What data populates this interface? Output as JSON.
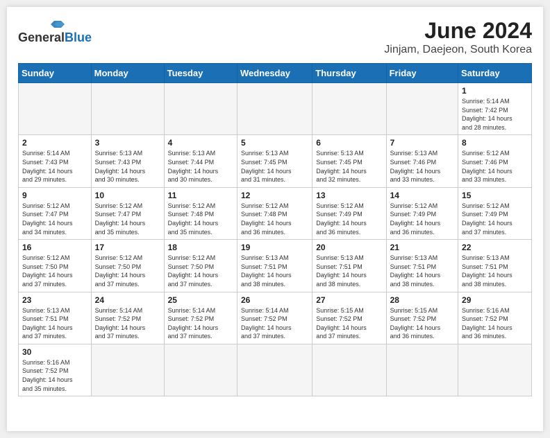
{
  "header": {
    "logo_general": "General",
    "logo_blue": "Blue",
    "month_year": "June 2024",
    "location": "Jinjam, Daejeon, South Korea"
  },
  "weekdays": [
    "Sunday",
    "Monday",
    "Tuesday",
    "Wednesday",
    "Thursday",
    "Friday",
    "Saturday"
  ],
  "weeks": [
    [
      {
        "day": "",
        "info": ""
      },
      {
        "day": "",
        "info": ""
      },
      {
        "day": "",
        "info": ""
      },
      {
        "day": "",
        "info": ""
      },
      {
        "day": "",
        "info": ""
      },
      {
        "day": "",
        "info": ""
      },
      {
        "day": "1",
        "info": "Sunrise: 5:14 AM\nSunset: 7:42 PM\nDaylight: 14 hours\nand 28 minutes."
      }
    ],
    [
      {
        "day": "2",
        "info": "Sunrise: 5:14 AM\nSunset: 7:43 PM\nDaylight: 14 hours\nand 29 minutes."
      },
      {
        "day": "3",
        "info": "Sunrise: 5:13 AM\nSunset: 7:43 PM\nDaylight: 14 hours\nand 30 minutes."
      },
      {
        "day": "4",
        "info": "Sunrise: 5:13 AM\nSunset: 7:44 PM\nDaylight: 14 hours\nand 30 minutes."
      },
      {
        "day": "5",
        "info": "Sunrise: 5:13 AM\nSunset: 7:45 PM\nDaylight: 14 hours\nand 31 minutes."
      },
      {
        "day": "6",
        "info": "Sunrise: 5:13 AM\nSunset: 7:45 PM\nDaylight: 14 hours\nand 32 minutes."
      },
      {
        "day": "7",
        "info": "Sunrise: 5:13 AM\nSunset: 7:46 PM\nDaylight: 14 hours\nand 33 minutes."
      },
      {
        "day": "8",
        "info": "Sunrise: 5:12 AM\nSunset: 7:46 PM\nDaylight: 14 hours\nand 33 minutes."
      }
    ],
    [
      {
        "day": "9",
        "info": "Sunrise: 5:12 AM\nSunset: 7:47 PM\nDaylight: 14 hours\nand 34 minutes."
      },
      {
        "day": "10",
        "info": "Sunrise: 5:12 AM\nSunset: 7:47 PM\nDaylight: 14 hours\nand 35 minutes."
      },
      {
        "day": "11",
        "info": "Sunrise: 5:12 AM\nSunset: 7:48 PM\nDaylight: 14 hours\nand 35 minutes."
      },
      {
        "day": "12",
        "info": "Sunrise: 5:12 AM\nSunset: 7:48 PM\nDaylight: 14 hours\nand 36 minutes."
      },
      {
        "day": "13",
        "info": "Sunrise: 5:12 AM\nSunset: 7:49 PM\nDaylight: 14 hours\nand 36 minutes."
      },
      {
        "day": "14",
        "info": "Sunrise: 5:12 AM\nSunset: 7:49 PM\nDaylight: 14 hours\nand 36 minutes."
      },
      {
        "day": "15",
        "info": "Sunrise: 5:12 AM\nSunset: 7:49 PM\nDaylight: 14 hours\nand 37 minutes."
      }
    ],
    [
      {
        "day": "16",
        "info": "Sunrise: 5:12 AM\nSunset: 7:50 PM\nDaylight: 14 hours\nand 37 minutes."
      },
      {
        "day": "17",
        "info": "Sunrise: 5:12 AM\nSunset: 7:50 PM\nDaylight: 14 hours\nand 37 minutes."
      },
      {
        "day": "18",
        "info": "Sunrise: 5:12 AM\nSunset: 7:50 PM\nDaylight: 14 hours\nand 37 minutes."
      },
      {
        "day": "19",
        "info": "Sunrise: 5:13 AM\nSunset: 7:51 PM\nDaylight: 14 hours\nand 38 minutes."
      },
      {
        "day": "20",
        "info": "Sunrise: 5:13 AM\nSunset: 7:51 PM\nDaylight: 14 hours\nand 38 minutes."
      },
      {
        "day": "21",
        "info": "Sunrise: 5:13 AM\nSunset: 7:51 PM\nDaylight: 14 hours\nand 38 minutes."
      },
      {
        "day": "22",
        "info": "Sunrise: 5:13 AM\nSunset: 7:51 PM\nDaylight: 14 hours\nand 38 minutes."
      }
    ],
    [
      {
        "day": "23",
        "info": "Sunrise: 5:13 AM\nSunset: 7:51 PM\nDaylight: 14 hours\nand 37 minutes."
      },
      {
        "day": "24",
        "info": "Sunrise: 5:14 AM\nSunset: 7:52 PM\nDaylight: 14 hours\nand 37 minutes."
      },
      {
        "day": "25",
        "info": "Sunrise: 5:14 AM\nSunset: 7:52 PM\nDaylight: 14 hours\nand 37 minutes."
      },
      {
        "day": "26",
        "info": "Sunrise: 5:14 AM\nSunset: 7:52 PM\nDaylight: 14 hours\nand 37 minutes."
      },
      {
        "day": "27",
        "info": "Sunrise: 5:15 AM\nSunset: 7:52 PM\nDaylight: 14 hours\nand 37 minutes."
      },
      {
        "day": "28",
        "info": "Sunrise: 5:15 AM\nSunset: 7:52 PM\nDaylight: 14 hours\nand 36 minutes."
      },
      {
        "day": "29",
        "info": "Sunrise: 5:16 AM\nSunset: 7:52 PM\nDaylight: 14 hours\nand 36 minutes."
      }
    ],
    [
      {
        "day": "30",
        "info": "Sunrise: 5:16 AM\nSunset: 7:52 PM\nDaylight: 14 hours\nand 35 minutes."
      },
      {
        "day": "",
        "info": ""
      },
      {
        "day": "",
        "info": ""
      },
      {
        "day": "",
        "info": ""
      },
      {
        "day": "",
        "info": ""
      },
      {
        "day": "",
        "info": ""
      },
      {
        "day": "",
        "info": ""
      }
    ]
  ]
}
